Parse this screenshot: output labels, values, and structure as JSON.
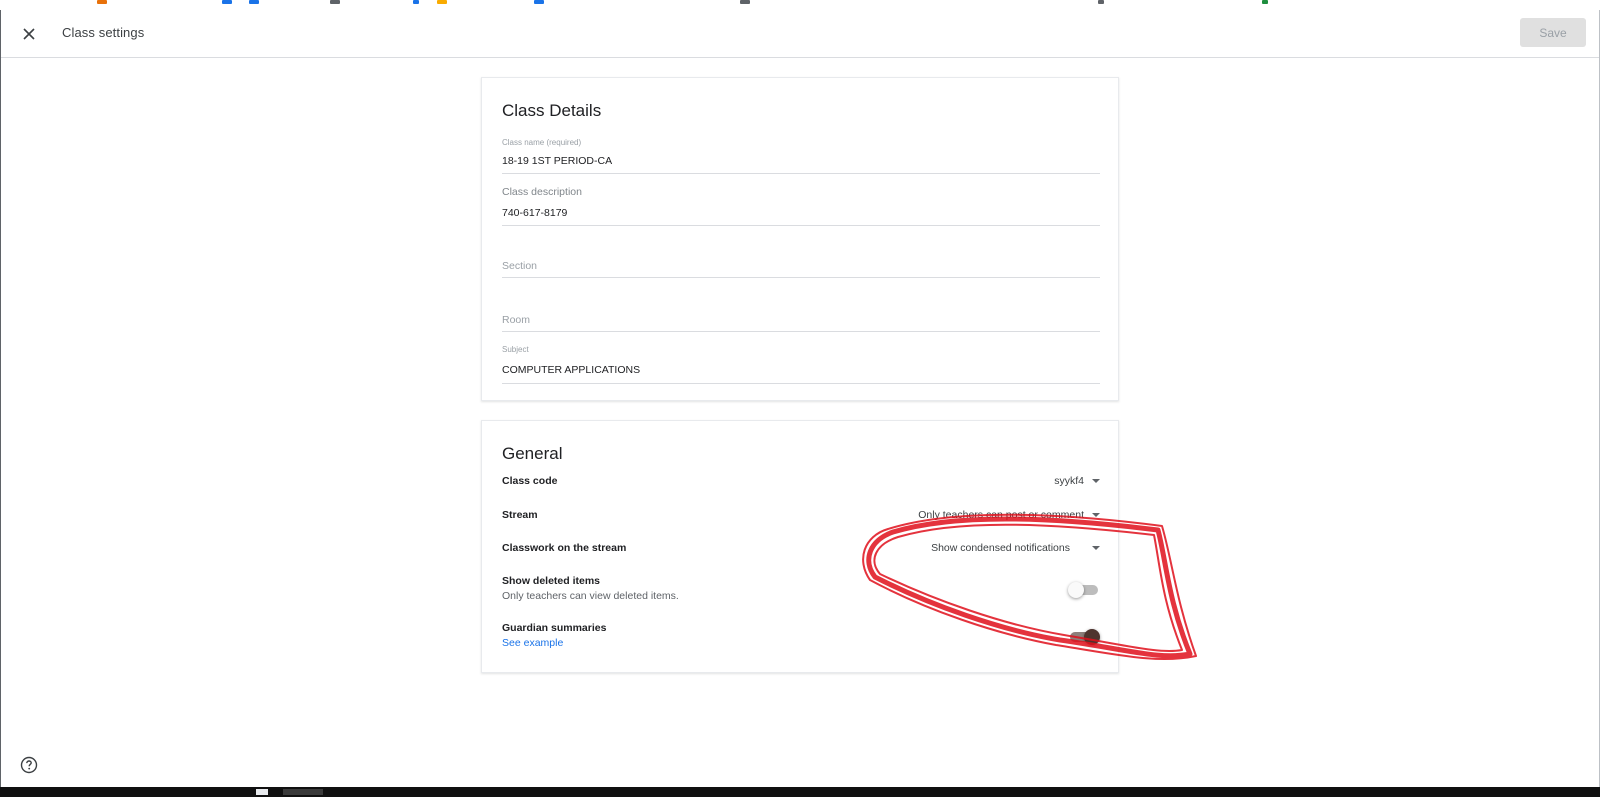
{
  "header": {
    "title": "Class settings",
    "save_label": "Save",
    "close_icon": "close-icon"
  },
  "class_details": {
    "title": "Class Details",
    "fields": [
      {
        "label": "Class name (required)",
        "value": "18-19 1ST PERIOD-CA"
      },
      {
        "label": "Class description",
        "value": "740-617-8179"
      },
      {
        "placeholder": "Section"
      },
      {
        "placeholder": "Room"
      },
      {
        "label": "Subject",
        "value": "COMPUTER APPLICATIONS"
      }
    ]
  },
  "general": {
    "title": "General",
    "class_code": {
      "label": "Class code",
      "value": "syykf4"
    },
    "stream": {
      "label": "Stream",
      "value": "Only teachers can post or comment"
    },
    "classwork_on_stream": {
      "label": "Classwork on the stream",
      "value": "Show condensed notifications"
    },
    "show_deleted": {
      "label": "Show deleted items",
      "description": "Only teachers can view deleted items.",
      "enabled": false
    },
    "guardian_summaries": {
      "label": "Guardian summaries",
      "link": "See example",
      "enabled": true
    }
  },
  "help_icon": "help-circle-icon",
  "colors": {
    "link": "#1a73e8",
    "toggle_on_thumb": "#4e342e",
    "toggle_on_track": "#8d7f7b",
    "toggle_off_track": "#bdbdbd",
    "annotation_scribble": "#e0101c"
  }
}
